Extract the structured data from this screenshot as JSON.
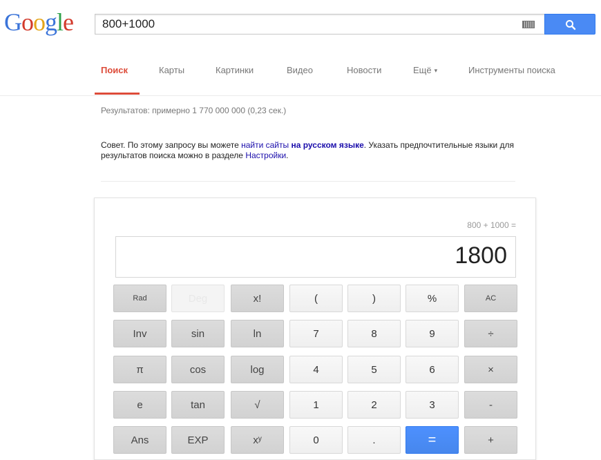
{
  "logo": "Google",
  "search": {
    "query": "800+1000"
  },
  "nav": {
    "tabs": [
      {
        "label": "Поиск",
        "active": true
      },
      {
        "label": "Карты"
      },
      {
        "label": "Картинки"
      },
      {
        "label": "Видео"
      },
      {
        "label": "Новости"
      },
      {
        "label": "Ещё"
      },
      {
        "label": "Инструменты поиска"
      }
    ],
    "more_caret": "▾"
  },
  "result_stats": "Результатов: примерно 1 770 000 000 (0,23 сек.)",
  "tip": {
    "prefix": "Совет. По этому запросу вы можете ",
    "link1_text": "найти сайты ",
    "link1_bold": "на русском языке",
    "middle": ". Указать предпочтительные языки для результатов поиска можно в разделе ",
    "link2_text": "Настройки",
    "suffix": "."
  },
  "calculator": {
    "history": "800 + 1000 =",
    "result": "1800",
    "rows": [
      [
        "Rad",
        "Deg",
        "x!",
        "(",
        ")",
        "%",
        "AC"
      ],
      [
        "Inv",
        "sin",
        "ln",
        "7",
        "8",
        "9",
        "÷"
      ],
      [
        "π",
        "cos",
        "log",
        "4",
        "5",
        "6",
        "×"
      ],
      [
        "e",
        "tan",
        "√",
        "1",
        "2",
        "3",
        "-"
      ],
      [
        "Ans",
        "EXP",
        "xʸ",
        "0",
        ".",
        "=",
        "+"
      ]
    ]
  },
  "colors": {
    "brand_blue": "#4a8af4",
    "active_tab": "#dd4b39",
    "link": "#1a0dab"
  }
}
